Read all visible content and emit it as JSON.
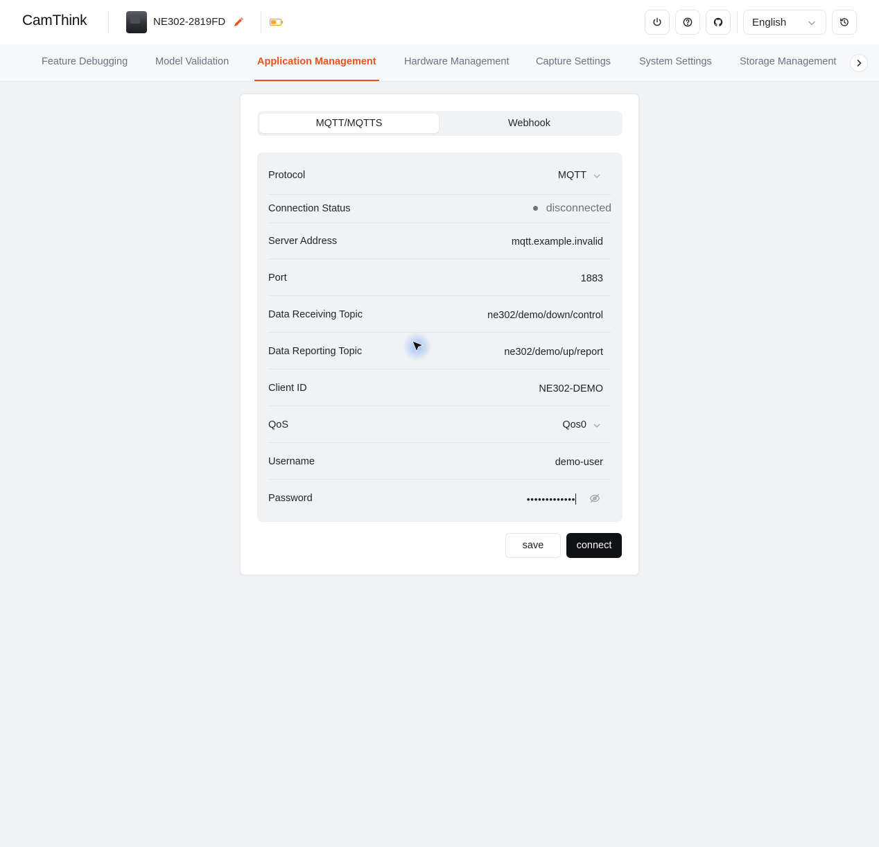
{
  "header": {
    "logo_text_a": "Cam",
    "logo_text_b": "Think",
    "device_name": "NE302-2819FD",
    "language": "English",
    "icons": [
      "power-icon",
      "help-icon",
      "github-icon",
      "history-icon",
      "edit-icon",
      "battery-icon"
    ],
    "accent_color": "#e8551e"
  },
  "nav": {
    "items": [
      {
        "label": "Feature Debugging"
      },
      {
        "label": "Model Validation"
      },
      {
        "label": "Application Management",
        "active": true
      },
      {
        "label": "Hardware Management"
      },
      {
        "label": "Capture Settings"
      },
      {
        "label": "System Settings"
      },
      {
        "label": "Storage Management"
      }
    ]
  },
  "tabs": {
    "mqtt": "MQTT/MQTTS",
    "webhook": "Webhook",
    "active": "MQTT/MQTTS"
  },
  "form": {
    "protocol": {
      "label": "Protocol",
      "value": "MQTT"
    },
    "connection_status": {
      "label": "Connection Status",
      "value": "disconnected"
    },
    "server_address": {
      "label": "Server Address",
      "value": "mqtt.example.invalid"
    },
    "port": {
      "label": "Port",
      "value": "1883"
    },
    "receiving_topic": {
      "label": "Data Receiving Topic",
      "value": "ne302/demo/down/control"
    },
    "reporting_topic": {
      "label": "Data Reporting Topic",
      "value": "ne302/demo/up/report"
    },
    "client_id": {
      "label": "Client ID",
      "value": "NE302-DEMO"
    },
    "qos": {
      "label": "QoS",
      "value": "Qos0"
    },
    "username": {
      "label": "Username",
      "value": "demo-user"
    },
    "password": {
      "label": "Password",
      "value": "•••••••••••••"
    }
  },
  "actions": {
    "save": "save",
    "connect": "connect"
  }
}
